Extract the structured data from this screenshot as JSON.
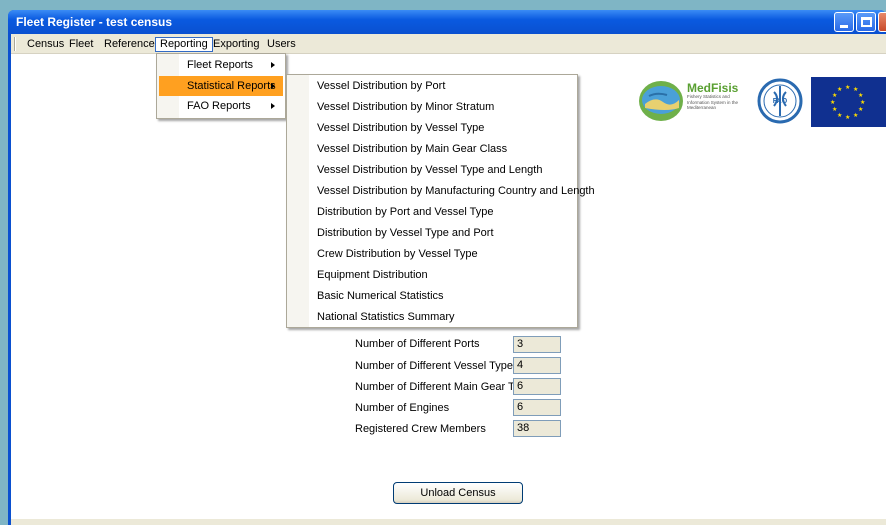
{
  "window": {
    "title": "Fleet Register - test census"
  },
  "menubar": {
    "items": [
      "Census",
      "Fleet",
      "Reference",
      "Reporting",
      "Exporting",
      "Users"
    ],
    "active": "Reporting"
  },
  "reporting_menu": {
    "items": [
      {
        "label": "Fleet Reports",
        "has_submenu": true
      },
      {
        "label": "Statistical Reports",
        "has_submenu": true,
        "highlighted": true
      },
      {
        "label": "FAO Reports",
        "has_submenu": true
      }
    ]
  },
  "statistical_reports_menu": {
    "items": [
      "Vessel Distribution by Port",
      "Vessel Distribution by Minor Stratum",
      "Vessel Distribution by Vessel Type",
      "Vessel Distribution by Main Gear Class",
      "Vessel Distribution by Vessel Type and Length",
      "Vessel Distribution by Manufacturing Country and Length",
      "Distribution by Port and Vessel Type",
      "Distribution by Vessel Type and Port",
      "Crew Distribution by Vessel Type",
      "Equipment Distribution",
      "Basic Numerical Statistics",
      "National Statistics Summary"
    ]
  },
  "logos": {
    "medfisis_name": "MedFisis",
    "medfisis_tagline": "Fishery Statistics and Information System in the Mediterranean",
    "fao_text": "FAO FIAT PANIS"
  },
  "stats": [
    {
      "label": "Number of Different Ports",
      "value": "3"
    },
    {
      "label": "Number of Different Vessel Types",
      "value": "4"
    },
    {
      "label": "Number of Different Main Gear Types",
      "value": "6"
    },
    {
      "label": "Number of Engines",
      "value": "6"
    },
    {
      "label": "Registered Crew Members",
      "value": "38"
    }
  ],
  "actions": {
    "unload_label": "Unload Census"
  },
  "colors": {
    "titlebar": "#0a50d0",
    "highlight": "#ffa020",
    "menu_active_border": "#316ac5"
  }
}
